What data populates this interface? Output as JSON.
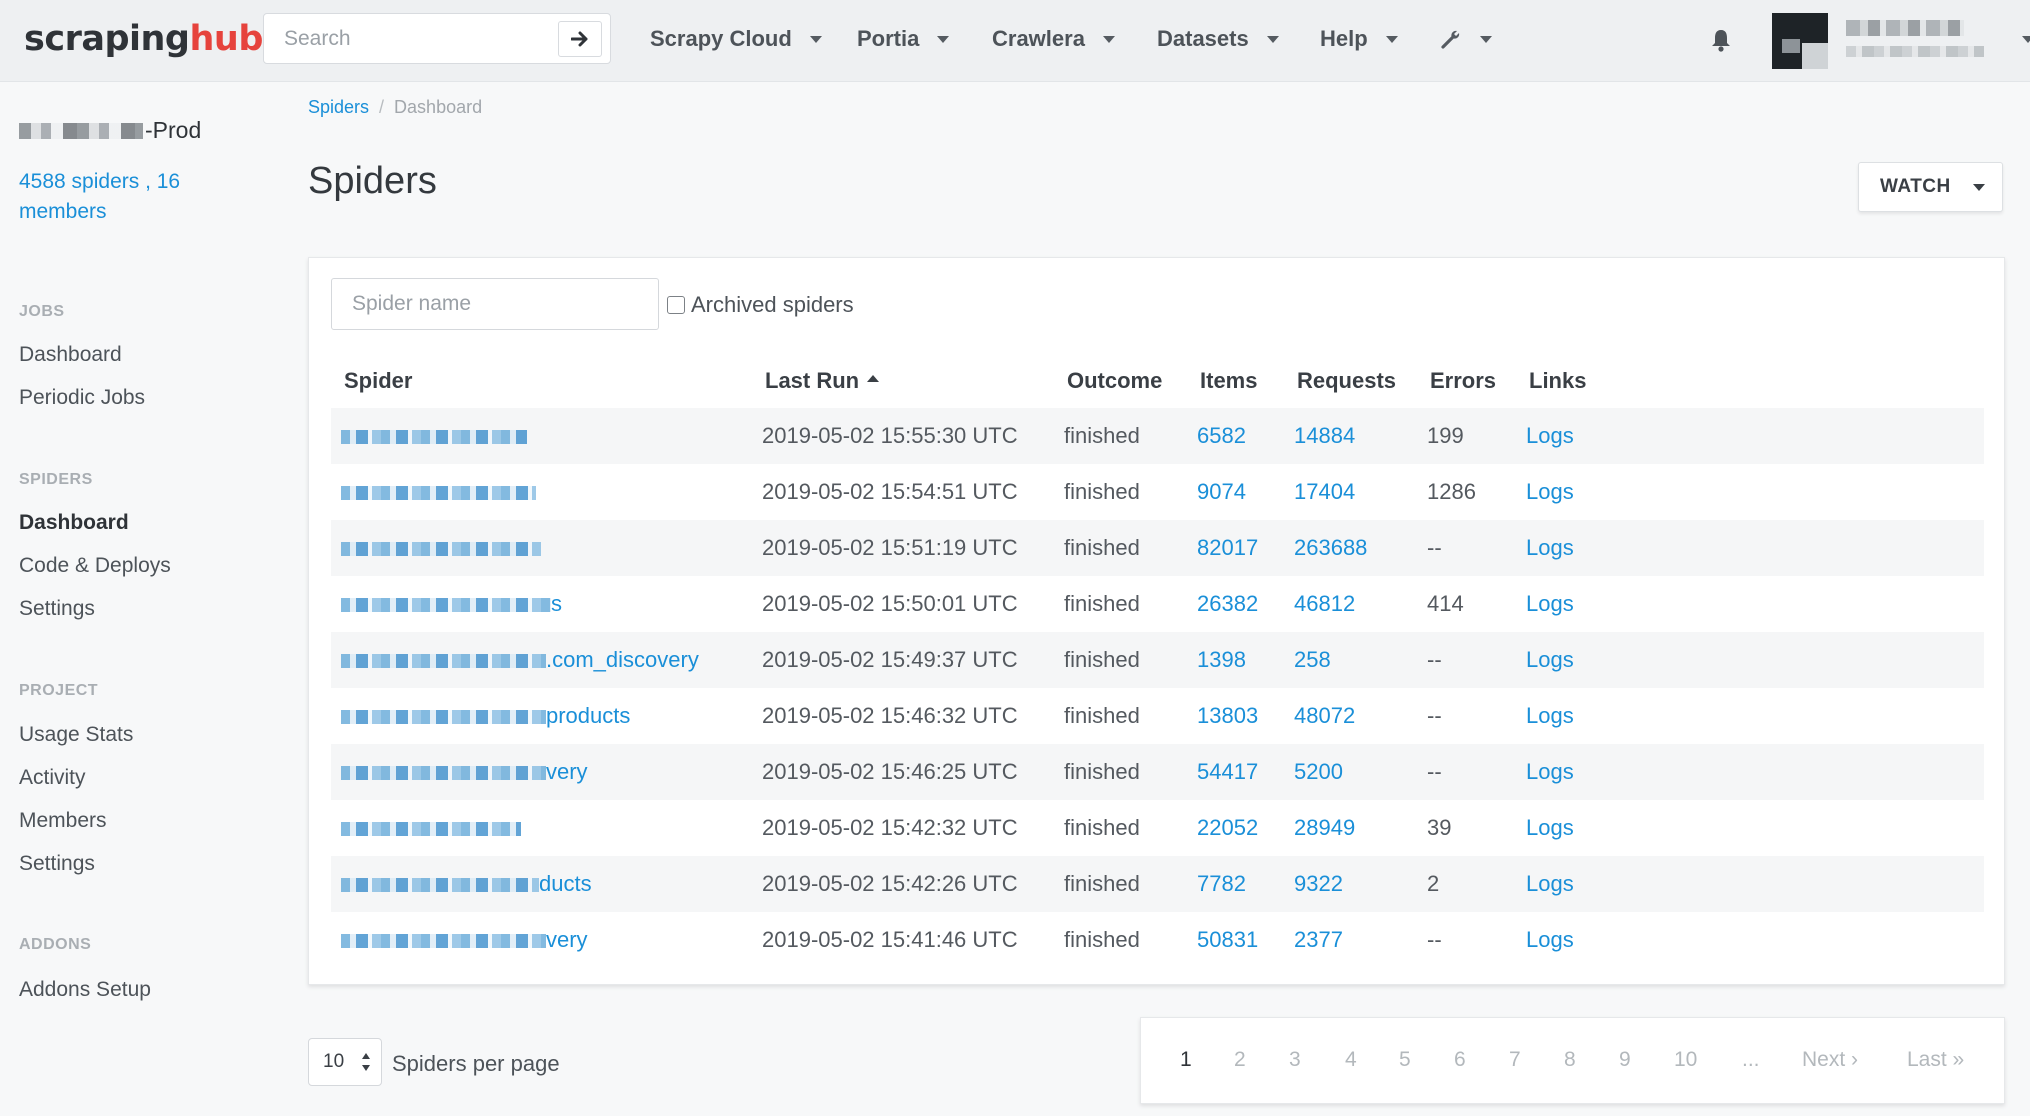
{
  "brand": {
    "part1": "scraping",
    "part2": "hub",
    "accent": "#e6433d"
  },
  "search": {
    "placeholder": "Search"
  },
  "nav": [
    "Scrapy Cloud",
    "Portia",
    "Crawlera",
    "Datasets",
    "Help"
  ],
  "icons": {
    "tools": "wrench-icon",
    "notifications": "bell-icon",
    "search_go": "arrow-right-icon"
  },
  "sidebar": {
    "org_suffix": "-Prod",
    "meta": "4588 spiders , 16 members",
    "sections": [
      {
        "title": "JOBS",
        "items": [
          "Dashboard",
          "Periodic Jobs"
        ]
      },
      {
        "title": "SPIDERS",
        "items": [
          "Dashboard",
          "Code & Deploys",
          "Settings"
        ]
      },
      {
        "title": "PROJECT",
        "items": [
          "Usage Stats",
          "Activity",
          "Members",
          "Settings"
        ]
      },
      {
        "title": "ADDONS",
        "items": [
          "Addons Setup"
        ]
      }
    ],
    "active": "Dashboard (Spiders)"
  },
  "breadcrumb": {
    "root": "Spiders",
    "sep": "/",
    "current": "Dashboard"
  },
  "page": {
    "title": "Spiders",
    "watch_label": "WATCH"
  },
  "filters": {
    "name_placeholder": "Spider name",
    "archived_label": "Archived spiders"
  },
  "table": {
    "headers": [
      "Spider",
      "Last Run",
      "Outcome",
      "Items",
      "Requests",
      "Errors",
      "Links"
    ],
    "sorted_by": "Last Run",
    "rows": [
      {
        "spider": "",
        "last_run": "2019-05-02 15:55:30 UTC",
        "outcome": "finished",
        "items": "6582",
        "requests": "14884",
        "errors": "199",
        "links": "Logs"
      },
      {
        "spider": "",
        "last_run": "2019-05-02 15:54:51 UTC",
        "outcome": "finished",
        "items": "9074",
        "requests": "17404",
        "errors": "1286",
        "links": "Logs"
      },
      {
        "spider": "",
        "last_run": "2019-05-02 15:51:19 UTC",
        "outcome": "finished",
        "items": "82017",
        "requests": "263688",
        "errors": "--",
        "links": "Logs"
      },
      {
        "spider": "s",
        "last_run": "2019-05-02 15:50:01 UTC",
        "outcome": "finished",
        "items": "26382",
        "requests": "46812",
        "errors": "414",
        "links": "Logs"
      },
      {
        "spider": ".com_discovery",
        "last_run": "2019-05-02 15:49:37 UTC",
        "outcome": "finished",
        "items": "1398",
        "requests": "258",
        "errors": "--",
        "links": "Logs"
      },
      {
        "spider": "products",
        "last_run": "2019-05-02 15:46:32 UTC",
        "outcome": "finished",
        "items": "13803",
        "requests": "48072",
        "errors": "--",
        "links": "Logs"
      },
      {
        "spider": "very",
        "last_run": "2019-05-02 15:46:25 UTC",
        "outcome": "finished",
        "items": "54417",
        "requests": "5200",
        "errors": "--",
        "links": "Logs"
      },
      {
        "spider": "",
        "last_run": "2019-05-02 15:42:32 UTC",
        "outcome": "finished",
        "items": "22052",
        "requests": "28949",
        "errors": "39",
        "links": "Logs"
      },
      {
        "spider": "ducts",
        "last_run": "2019-05-02 15:42:26 UTC",
        "outcome": "finished",
        "items": "7782",
        "requests": "9322",
        "errors": "2",
        "links": "Logs"
      },
      {
        "spider": "very",
        "last_run": "2019-05-02 15:41:46 UTC",
        "outcome": "finished",
        "items": "50831",
        "requests": "2377",
        "errors": "--",
        "links": "Logs"
      }
    ]
  },
  "pagination": {
    "per_page_value": "10",
    "per_page_label": "Spiders per page",
    "pages": [
      "1",
      "2",
      "3",
      "4",
      "5",
      "6",
      "7",
      "8",
      "9",
      "10",
      "..."
    ],
    "current": "1",
    "next": "Next ›",
    "last": "Last »"
  }
}
